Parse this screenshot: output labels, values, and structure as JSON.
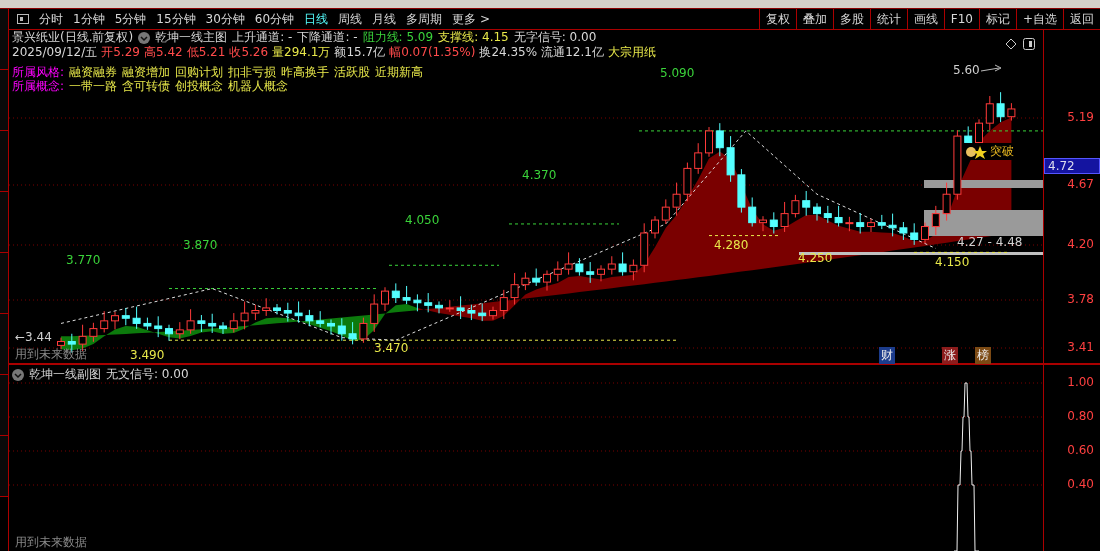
{
  "toolbar": {
    "tabs": [
      {
        "label": "分时",
        "selected": false
      },
      {
        "label": "1分钟",
        "selected": false
      },
      {
        "label": "5分钟",
        "selected": false
      },
      {
        "label": "15分钟",
        "selected": false
      },
      {
        "label": "30分钟",
        "selected": false
      },
      {
        "label": "60分钟",
        "selected": false
      },
      {
        "label": "日线",
        "selected": true
      },
      {
        "label": "周线",
        "selected": false
      },
      {
        "label": "月线",
        "selected": false
      },
      {
        "label": "多周期",
        "selected": false
      },
      {
        "label": "更多 >",
        "selected": false
      }
    ],
    "buttons": [
      "复权",
      "叠加",
      "多股",
      "统计",
      "画线",
      "F10",
      "标记",
      "+自选",
      "返回"
    ]
  },
  "main_chart": {
    "stock": "景兴纸业(日线.前复权)",
    "indicator": "乾坤一线主图",
    "fields": [
      {
        "text": "上升通道: -",
        "kind": "plain"
      },
      {
        "text": "下降通道: -",
        "kind": "plain"
      },
      {
        "text": "阻力线: 5.09",
        "kind": "resistance"
      },
      {
        "text": "支撑线: 4.15",
        "kind": "support"
      },
      {
        "text": "无字信号: 0.00",
        "kind": "plain"
      }
    ],
    "quote": [
      {
        "text": "2025/09/12/五",
        "kind": "plain"
      },
      {
        "text": "开5.29",
        "kind": "up"
      },
      {
        "text": "高5.42",
        "kind": "up"
      },
      {
        "text": "低5.21",
        "kind": "up"
      },
      {
        "text": "收5.26",
        "kind": "up"
      },
      {
        "text": "量294.1万",
        "kind": "volume"
      },
      {
        "text": "额15.7亿",
        "kind": "plain"
      },
      {
        "text": "幅0.07(1.35%)",
        "kind": "up"
      },
      {
        "text": "换24.35%",
        "kind": "plain"
      },
      {
        "text": "流通12.1亿",
        "kind": "plain"
      },
      {
        "text": "大宗用纸",
        "kind": "volume"
      }
    ],
    "style_label": "所属风格:",
    "styles": [
      "融资融券",
      "融资增加",
      "回购计划",
      "扣非亏损",
      "昨高换手",
      "活跃股",
      "近期新高"
    ],
    "concept_label": "所属概念:",
    "concepts": [
      "一带一路",
      "含可转债",
      "创投概念",
      "机器人概念"
    ],
    "price_labels": [
      {
        "text": "5.090",
        "kind": "peak"
      },
      {
        "text": "4.370",
        "kind": "peak"
      },
      {
        "text": "4.050",
        "kind": "peak"
      },
      {
        "text": "3.870",
        "kind": "peak"
      },
      {
        "text": "3.770",
        "kind": "peak"
      },
      {
        "text": "3.490",
        "kind": "trough"
      },
      {
        "text": "3.470",
        "kind": "trough"
      },
      {
        "text": "4.280",
        "kind": "trough"
      },
      {
        "text": "4.250",
        "kind": "trough"
      },
      {
        "text": "4.150",
        "kind": "trough"
      },
      {
        "text": "5.60",
        "kind": "note"
      },
      {
        "text": "4.27 - 4.48",
        "kind": "note"
      },
      {
        "text": "←3.44",
        "kind": "note"
      }
    ],
    "signal": "突破",
    "markers": [
      {
        "text": "财",
        "kind": "finance"
      },
      {
        "text": "涨",
        "kind": "rise"
      },
      {
        "text": "榜",
        "kind": "list"
      }
    ],
    "note": "用到未来数据",
    "axis": [
      "5.19",
      "4.67",
      "4.20",
      "3.78",
      "3.41"
    ],
    "current_price": "4.72"
  },
  "sub_chart": {
    "title": "乾坤一线副图",
    "signal": "无文信号: 0.00",
    "axis": [
      "1.00",
      "0.80",
      "0.60",
      "0.40"
    ],
    "note": "用到未来数据"
  }
}
